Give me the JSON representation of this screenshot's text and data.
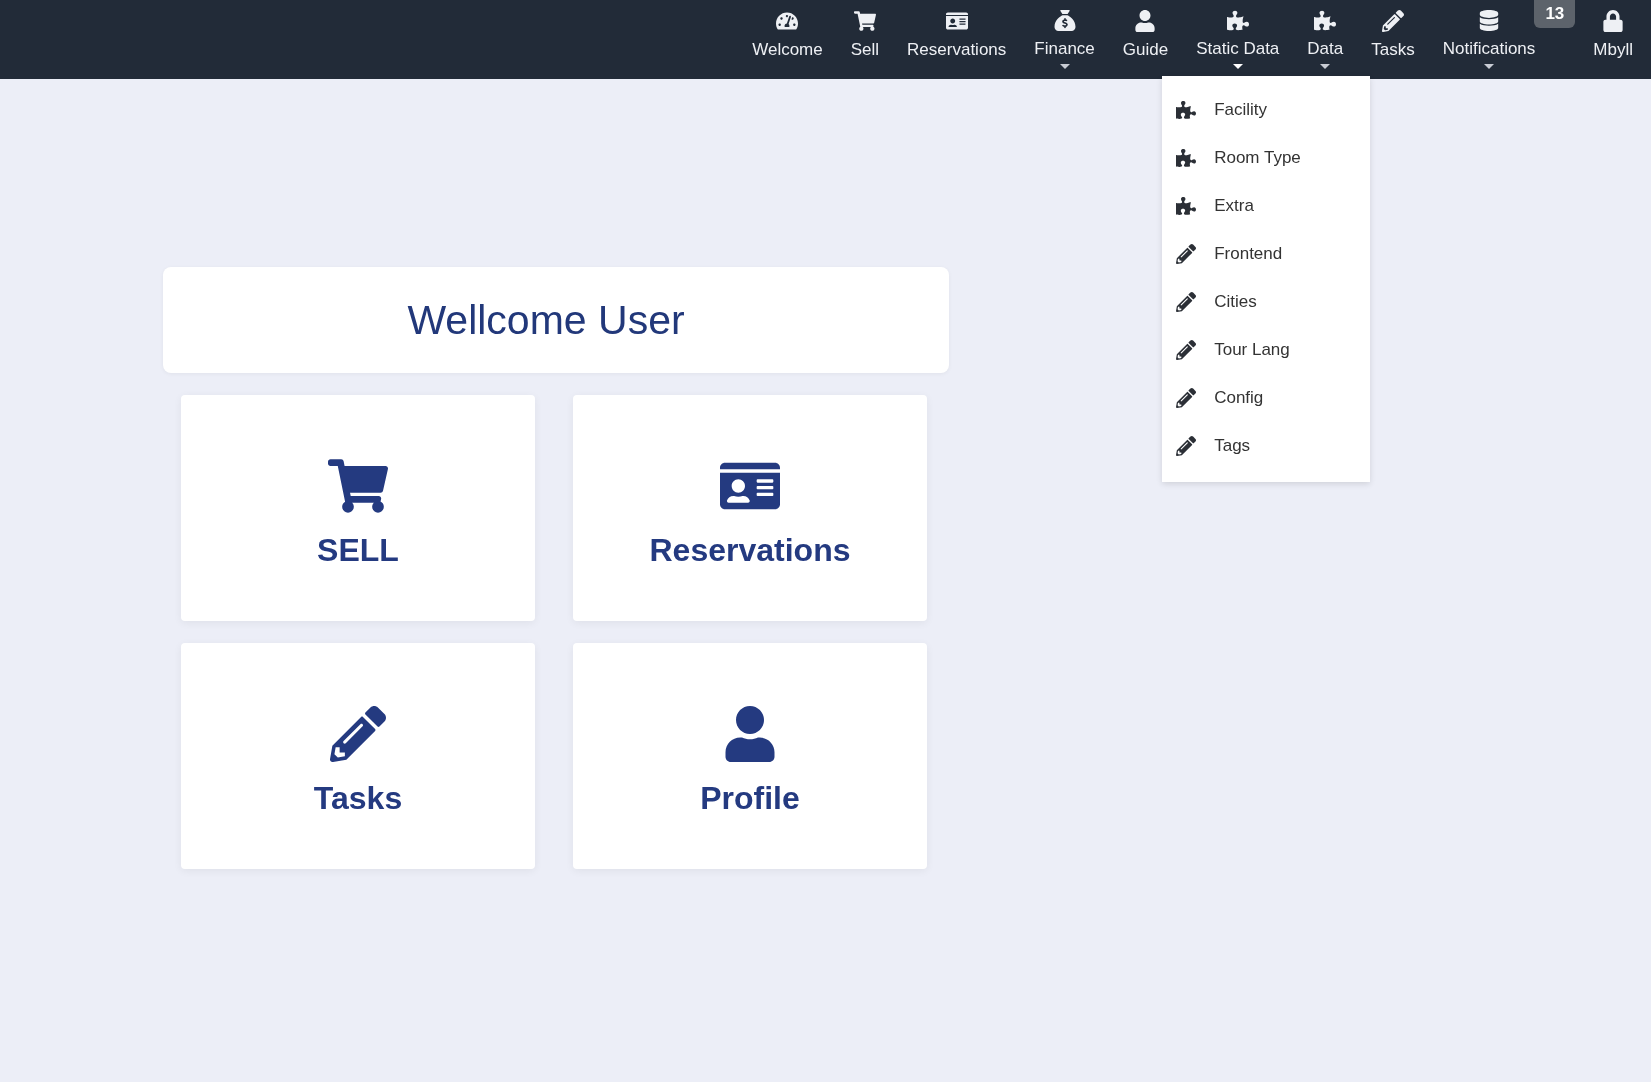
{
  "nav": {
    "items": [
      {
        "label": "Welcome",
        "has_menu": false,
        "expanded": false
      },
      {
        "label": "Sell",
        "has_menu": false,
        "expanded": false
      },
      {
        "label": "Reservations",
        "has_menu": false,
        "expanded": false
      },
      {
        "label": "Finance",
        "has_menu": true,
        "expanded": false
      },
      {
        "label": "Guide",
        "has_menu": false,
        "expanded": false
      },
      {
        "label": "Static Data",
        "has_menu": true,
        "expanded": true,
        "menu": [
          "Facility",
          "Room Type",
          "Extra",
          "Frontend",
          "Cities",
          "Tour Lang",
          "Config",
          "Tags"
        ]
      },
      {
        "label": "Data",
        "has_menu": true,
        "expanded": false
      },
      {
        "label": "Tasks",
        "has_menu": false,
        "expanded": false
      },
      {
        "label": "Notifications",
        "has_menu": true,
        "expanded": false,
        "badge": "13"
      },
      {
        "label": "Mbyll",
        "has_menu": false,
        "expanded": false
      }
    ]
  },
  "welcome": {
    "title": "Wellcome User"
  },
  "tiles": [
    "SELL",
    "Reservations",
    "Tasks",
    "Profile"
  ]
}
